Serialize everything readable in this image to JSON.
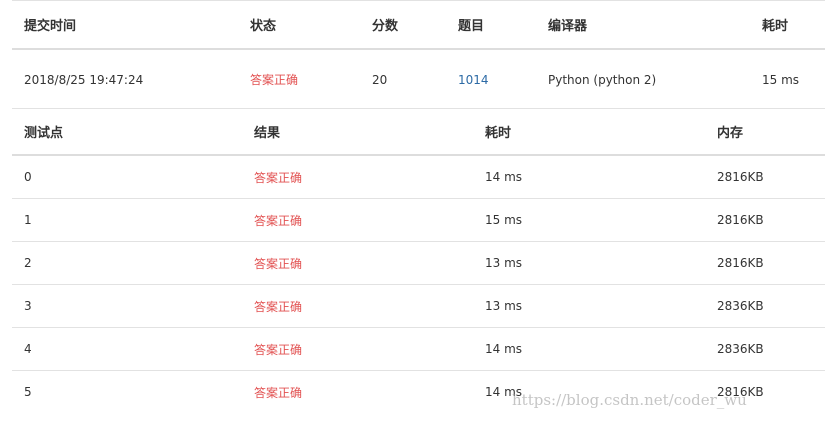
{
  "submission": {
    "headers": {
      "time": "提交时间",
      "status": "状态",
      "score": "分数",
      "problem": "题目",
      "compiler": "编译器",
      "cost": "耗时"
    },
    "row": {
      "time": "2018/8/25 19:47:24",
      "status": "答案正确",
      "score": "20",
      "problem": "1014",
      "compiler": "Python (python 2)",
      "cost": "15 ms"
    }
  },
  "testcases": {
    "headers": {
      "point": "测试点",
      "result": "结果",
      "time": "耗时",
      "memory": "内存"
    },
    "rows": [
      {
        "point": "0",
        "result": "答案正确",
        "time": "14 ms",
        "memory": "2816KB"
      },
      {
        "point": "1",
        "result": "答案正确",
        "time": "15 ms",
        "memory": "2816KB"
      },
      {
        "point": "2",
        "result": "答案正确",
        "time": "13 ms",
        "memory": "2816KB"
      },
      {
        "point": "3",
        "result": "答案正确",
        "time": "13 ms",
        "memory": "2836KB"
      },
      {
        "point": "4",
        "result": "答案正确",
        "time": "14 ms",
        "memory": "2836KB"
      },
      {
        "point": "5",
        "result": "答案正确",
        "time": "14 ms",
        "memory": "2816KB"
      }
    ]
  },
  "watermark": "https://blog.csdn.net/coder_wu",
  "colors": {
    "accepted": "#e25151",
    "link": "#2c6aa5",
    "border": "#dddddd"
  }
}
